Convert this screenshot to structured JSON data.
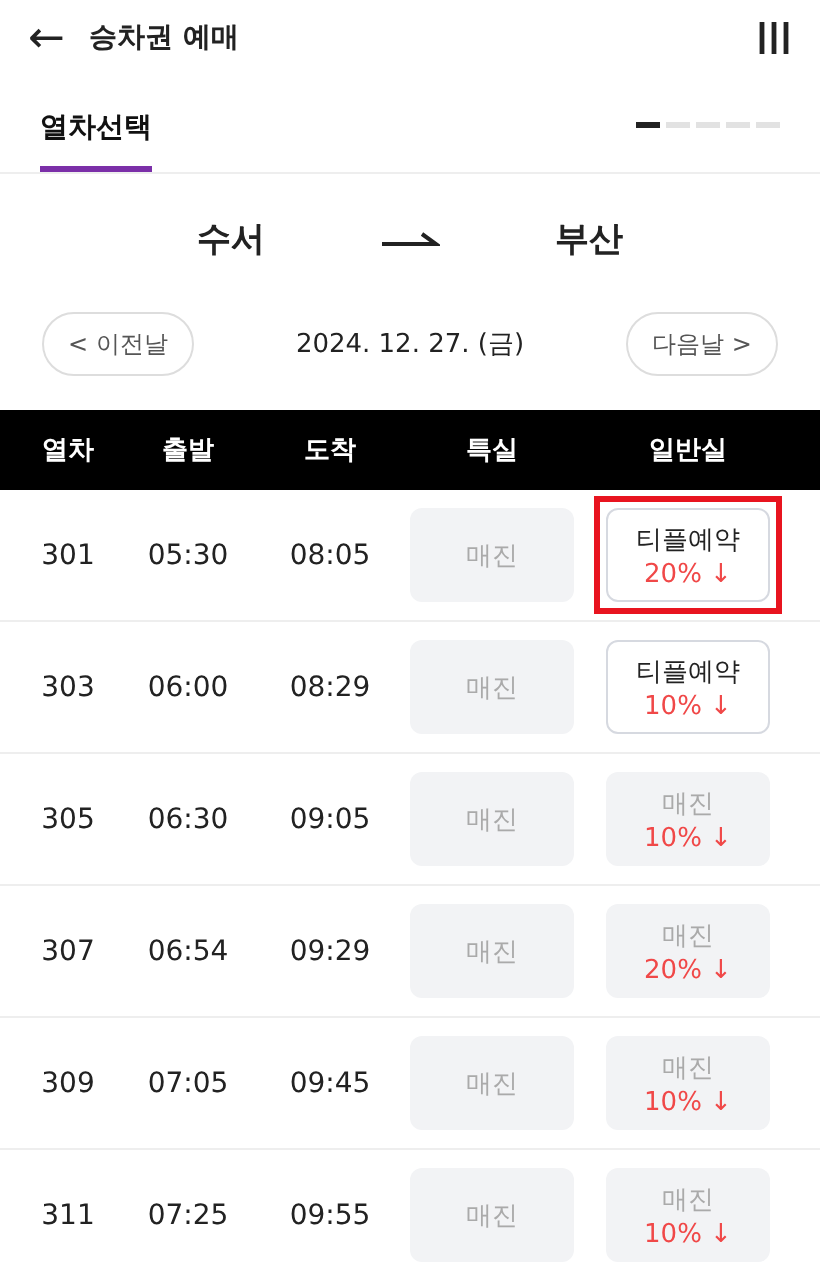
{
  "header": {
    "title": "승차권 예매",
    "back": "←"
  },
  "tabs": [
    {
      "label": "열차선택",
      "selected": true
    }
  ],
  "steps": [
    {
      "selected": true
    },
    {
      "selected": false
    },
    {
      "selected": false
    },
    {
      "selected": false
    },
    {
      "selected": false
    }
  ],
  "route": {
    "from": "수서",
    "to": "부산"
  },
  "date_nav": {
    "prev": "< 이전날",
    "date": "2024. 12. 27. (금)",
    "next": "다음날 >"
  },
  "table": {
    "columns": [
      "열차",
      "출발",
      "도착",
      "특실",
      "일반실"
    ],
    "rows": [
      {
        "train": "301",
        "depart": "05:30",
        "arrive": "08:05",
        "special": {
          "label": "매진",
          "available": false
        },
        "general": {
          "label": "티플예약",
          "discount": "20% ↓",
          "available": true,
          "highlighted": true
        }
      },
      {
        "train": "303",
        "depart": "06:00",
        "arrive": "08:29",
        "special": {
          "label": "매진",
          "available": false
        },
        "general": {
          "label": "티플예약",
          "discount": "10% ↓",
          "available": true,
          "highlighted": false
        }
      },
      {
        "train": "305",
        "depart": "06:30",
        "arrive": "09:05",
        "special": {
          "label": "매진",
          "available": false
        },
        "general": {
          "label": "매진",
          "discount": "10% ↓",
          "available": false,
          "highlighted": false
        }
      },
      {
        "train": "307",
        "depart": "06:54",
        "arrive": "09:29",
        "special": {
          "label": "매진",
          "available": false
        },
        "general": {
          "label": "매진",
          "discount": "20% ↓",
          "available": false,
          "highlighted": false
        }
      },
      {
        "train": "309",
        "depart": "07:05",
        "arrive": "09:45",
        "special": {
          "label": "매진",
          "available": false
        },
        "general": {
          "label": "매진",
          "discount": "10% ↓",
          "available": false,
          "highlighted": false
        }
      },
      {
        "train": "311",
        "depart": "07:25",
        "arrive": "09:55",
        "special": {
          "label": "매진",
          "available": false
        },
        "general": {
          "label": "매진",
          "discount": "10% ↓",
          "available": false,
          "highlighted": false
        }
      }
    ]
  }
}
